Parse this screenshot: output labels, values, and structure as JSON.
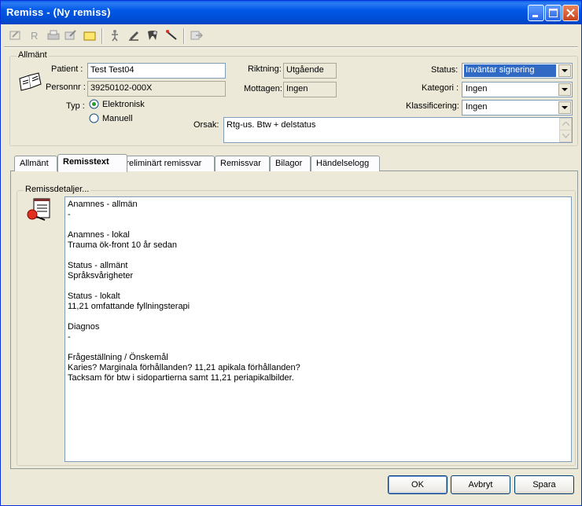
{
  "window": {
    "title": "Remiss - (Ny remiss)"
  },
  "toolbar": {
    "icons": [
      "edit-icon",
      "r-icon",
      "print-icon",
      "sign-icon",
      "folder-icon",
      "person-icon",
      "write-icon",
      "tooth-icon",
      "pen-icon",
      "export-icon"
    ]
  },
  "general": {
    "legend": "Allmänt",
    "patient_label": "Patient :",
    "patient_value": "Test Test04",
    "personnr_label": "Personnr :",
    "personnr_value": "39250102-000X",
    "typ_label": "Typ :",
    "typ_options": [
      "Elektronisk",
      "Manuell"
    ],
    "typ_selected": "Elektronisk",
    "riktning_label": "Riktning:",
    "riktning_value": "Utgående",
    "mottagen_label": "Mottagen:",
    "mottagen_value": "Ingen",
    "status_label": "Status:",
    "status_value": "Inväntar signering",
    "kategori_label": "Kategori :",
    "kategori_value": "Ingen",
    "klass_label": "Klassificering:",
    "klass_value": "Ingen",
    "orsak_label": "Orsak:",
    "orsak_value": "Rtg-us. Btw + delstatus"
  },
  "tabs": [
    {
      "label": "Allmänt",
      "active": false
    },
    {
      "label": "Remisstext",
      "active": true
    },
    {
      "label": "Preliminärt remissvar",
      "active": false
    },
    {
      "label": "Remissvar",
      "active": false
    },
    {
      "label": "Bilagor",
      "active": false
    },
    {
      "label": "Händelselogg",
      "active": false
    }
  ],
  "details": {
    "legend": "Remissdetaljer...",
    "lines": [
      "Anamnes - allmän",
      "-",
      "",
      "Anamnes - lokal",
      "Trauma ök-front 10 år sedan",
      "",
      "Status - allmänt",
      "Språksvårigheter",
      "",
      "Status - lokalt",
      "11,21 omfattande fyllningsterapi",
      "",
      "Diagnos",
      "-",
      "",
      "Frågeställning / Önskemål",
      "Karies? Marginala förhållanden? 11,21 apikala förhållanden?",
      "Tacksam för btw i sidopartierna samt 11,21 periapikalbilder."
    ]
  },
  "buttons": {
    "ok": "OK",
    "cancel": "Avbryt",
    "save": "Spara"
  },
  "colors": {
    "titlebar": "#0054E3",
    "selection": "#316AC5",
    "face": "#ECE9D8"
  }
}
